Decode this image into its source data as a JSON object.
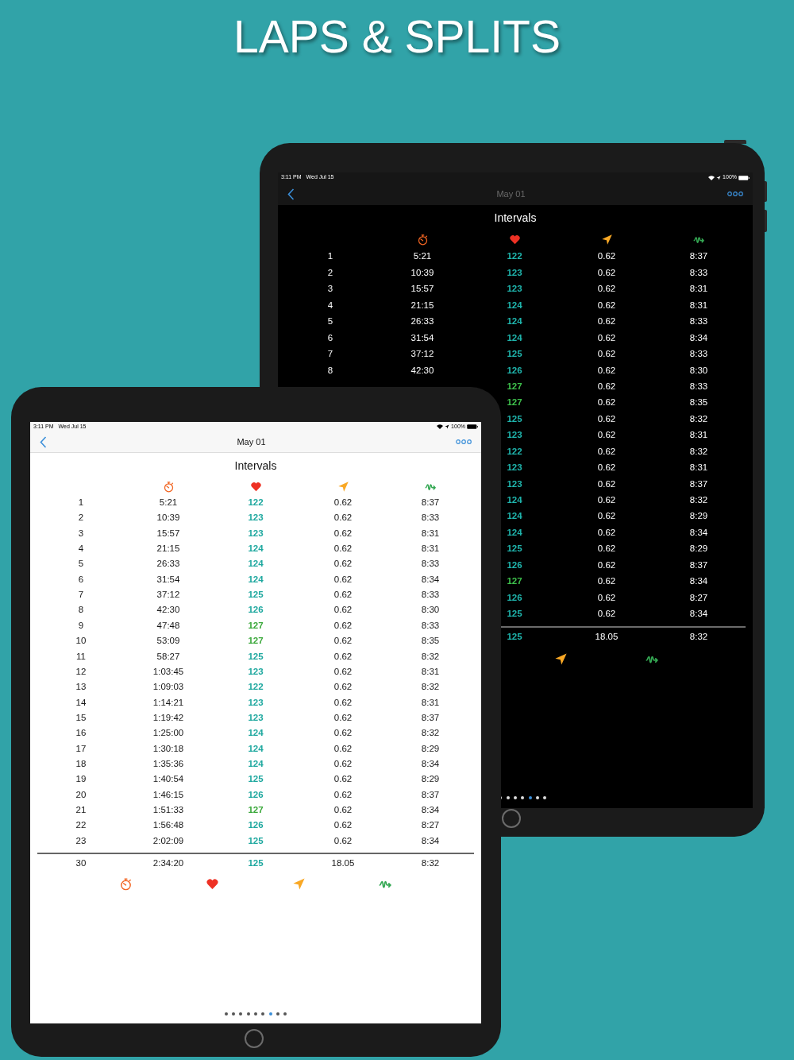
{
  "headline": "LAPS & SPLITS",
  "devices": [
    {
      "dark": true,
      "status_bar": {
        "time": "3:11 PM",
        "date": "Wed Jul 15",
        "battery": "100%"
      },
      "nav": {
        "title": "May 01"
      },
      "table": {
        "title": "Intervals",
        "rows": [
          {
            "lap": "1",
            "time": "5:21",
            "hr": "122",
            "color": "#1fb5ad",
            "distance": "0.62",
            "pace": "8:37"
          },
          {
            "lap": "2",
            "time": "10:39",
            "hr": "123",
            "color": "#1fb5ad",
            "distance": "0.62",
            "pace": "8:33"
          },
          {
            "lap": "3",
            "time": "15:57",
            "hr": "123",
            "color": "#1fb5ad",
            "distance": "0.62",
            "pace": "8:31"
          },
          {
            "lap": "4",
            "time": "21:15",
            "hr": "124",
            "color": "#1fb5ad",
            "distance": "0.62",
            "pace": "8:31"
          },
          {
            "lap": "5",
            "time": "26:33",
            "hr": "124",
            "color": "#1fb5ad",
            "distance": "0.62",
            "pace": "8:33"
          },
          {
            "lap": "6",
            "time": "31:54",
            "hr": "124",
            "color": "#1fb5ad",
            "distance": "0.62",
            "pace": "8:34"
          },
          {
            "lap": "7",
            "time": "37:12",
            "hr": "125",
            "color": "#1fb5ad",
            "distance": "0.62",
            "pace": "8:33"
          },
          {
            "lap": "8",
            "time": "42:30",
            "hr": "126",
            "color": "#1fb5ad",
            "distance": "0.62",
            "pace": "8:30"
          },
          {
            "hr": "127",
            "color": "#3ec04c",
            "distance": "0.62",
            "pace": "8:33"
          },
          {
            "hr": "127",
            "color": "#3ec04c",
            "distance": "0.62",
            "pace": "8:35"
          },
          {
            "hr": "125",
            "color": "#1fb5ad",
            "distance": "0.62",
            "pace": "8:32"
          },
          {
            "hr": "123",
            "color": "#1fb5ad",
            "distance": "0.62",
            "pace": "8:31"
          },
          {
            "hr": "122",
            "color": "#1fb5ad",
            "distance": "0.62",
            "pace": "8:32"
          },
          {
            "hr": "123",
            "color": "#1fb5ad",
            "distance": "0.62",
            "pace": "8:31"
          },
          {
            "hr": "123",
            "color": "#1fb5ad",
            "distance": "0.62",
            "pace": "8:37"
          },
          {
            "hr": "124",
            "color": "#1fb5ad",
            "distance": "0.62",
            "pace": "8:32"
          },
          {
            "hr": "124",
            "color": "#1fb5ad",
            "distance": "0.62",
            "pace": "8:29"
          },
          {
            "hr": "124",
            "color": "#1fb5ad",
            "distance": "0.62",
            "pace": "8:34"
          },
          {
            "hr": "125",
            "color": "#1fb5ad",
            "distance": "0.62",
            "pace": "8:29"
          },
          {
            "hr": "126",
            "color": "#1fb5ad",
            "distance": "0.62",
            "pace": "8:37"
          },
          {
            "hr": "127",
            "color": "#3ec04c",
            "distance": "0.62",
            "pace": "8:34"
          },
          {
            "hr": "126",
            "color": "#1fb5ad",
            "distance": "0.62",
            "pace": "8:27"
          },
          {
            "hr": "125",
            "color": "#1fb5ad",
            "distance": "0.62",
            "pace": "8:34"
          }
        ],
        "totals": {
          "hr": "125",
          "color": "#1fb5ad",
          "distance": "18.05",
          "pace": "8:32"
        }
      },
      "page_dots": [
        {
          "selected": false
        },
        {
          "selected": false
        },
        {
          "selected": false
        },
        {
          "selected": false
        },
        {
          "selected": true
        },
        {
          "selected": false
        },
        {
          "selected": false
        }
      ]
    },
    {
      "dark": false,
      "status_bar": {
        "time": "3:11 PM",
        "date": "Wed Jul 15",
        "battery": "100%"
      },
      "nav": {
        "title": "May 01"
      },
      "table": {
        "title": "Intervals",
        "rows": [
          {
            "lap": "1",
            "time": "5:21",
            "hr": "122",
            "color": "#1ea89f",
            "distance": "0.62",
            "pace": "8:37"
          },
          {
            "lap": "2",
            "time": "10:39",
            "hr": "123",
            "color": "#1ea89f",
            "distance": "0.62",
            "pace": "8:33"
          },
          {
            "lap": "3",
            "time": "15:57",
            "hr": "123",
            "color": "#1ea89f",
            "distance": "0.62",
            "pace": "8:31"
          },
          {
            "lap": "4",
            "time": "21:15",
            "hr": "124",
            "color": "#1ea89f",
            "distance": "0.62",
            "pace": "8:31"
          },
          {
            "lap": "5",
            "time": "26:33",
            "hr": "124",
            "color": "#1ea89f",
            "distance": "0.62",
            "pace": "8:33"
          },
          {
            "lap": "6",
            "time": "31:54",
            "hr": "124",
            "color": "#1ea89f",
            "distance": "0.62",
            "pace": "8:34"
          },
          {
            "lap": "7",
            "time": "37:12",
            "hr": "125",
            "color": "#1ea89f",
            "distance": "0.62",
            "pace": "8:33"
          },
          {
            "lap": "8",
            "time": "42:30",
            "hr": "126",
            "color": "#1ea89f",
            "distance": "0.62",
            "pace": "8:30"
          },
          {
            "lap": "9",
            "time": "47:48",
            "hr": "127",
            "color": "#3aa83a",
            "distance": "0.62",
            "pace": "8:33"
          },
          {
            "lap": "10",
            "time": "53:09",
            "hr": "127",
            "color": "#3aa83a",
            "distance": "0.62",
            "pace": "8:35"
          },
          {
            "lap": "11",
            "time": "58:27",
            "hr": "125",
            "color": "#1ea89f",
            "distance": "0.62",
            "pace": "8:32"
          },
          {
            "lap": "12",
            "time": "1:03:45",
            "hr": "123",
            "color": "#1ea89f",
            "distance": "0.62",
            "pace": "8:31"
          },
          {
            "lap": "13",
            "time": "1:09:03",
            "hr": "122",
            "color": "#1ea89f",
            "distance": "0.62",
            "pace": "8:32"
          },
          {
            "lap": "14",
            "time": "1:14:21",
            "hr": "123",
            "color": "#1ea89f",
            "distance": "0.62",
            "pace": "8:31"
          },
          {
            "lap": "15",
            "time": "1:19:42",
            "hr": "123",
            "color": "#1ea89f",
            "distance": "0.62",
            "pace": "8:37"
          },
          {
            "lap": "16",
            "time": "1:25:00",
            "hr": "124",
            "color": "#1ea89f",
            "distance": "0.62",
            "pace": "8:32"
          },
          {
            "lap": "17",
            "time": "1:30:18",
            "hr": "124",
            "color": "#1ea89f",
            "distance": "0.62",
            "pace": "8:29"
          },
          {
            "lap": "18",
            "time": "1:35:36",
            "hr": "124",
            "color": "#1ea89f",
            "distance": "0.62",
            "pace": "8:34"
          },
          {
            "lap": "19",
            "time": "1:40:54",
            "hr": "125",
            "color": "#1ea89f",
            "distance": "0.62",
            "pace": "8:29"
          },
          {
            "lap": "20",
            "time": "1:46:15",
            "hr": "126",
            "color": "#1ea89f",
            "distance": "0.62",
            "pace": "8:37"
          },
          {
            "lap": "21",
            "time": "1:51:33",
            "hr": "127",
            "color": "#3aa83a",
            "distance": "0.62",
            "pace": "8:34"
          },
          {
            "lap": "22",
            "time": "1:56:48",
            "hr": "126",
            "color": "#1ea89f",
            "distance": "0.62",
            "pace": "8:27"
          },
          {
            "lap": "23",
            "time": "2:02:09",
            "hr": "125",
            "color": "#1ea89f",
            "distance": "0.62",
            "pace": "8:34"
          }
        ],
        "totals": {
          "lap": "30",
          "time": "2:34:20",
          "hr": "125",
          "color": "#1ea89f",
          "distance": "18.05",
          "pace": "8:32"
        }
      },
      "page_dots": [
        {
          "selected": false
        },
        {
          "selected": false
        },
        {
          "selected": false
        },
        {
          "selected": false
        },
        {
          "selected": false
        },
        {
          "selected": false
        },
        {
          "selected": true
        },
        {
          "selected": false
        },
        {
          "selected": false
        }
      ]
    }
  ]
}
